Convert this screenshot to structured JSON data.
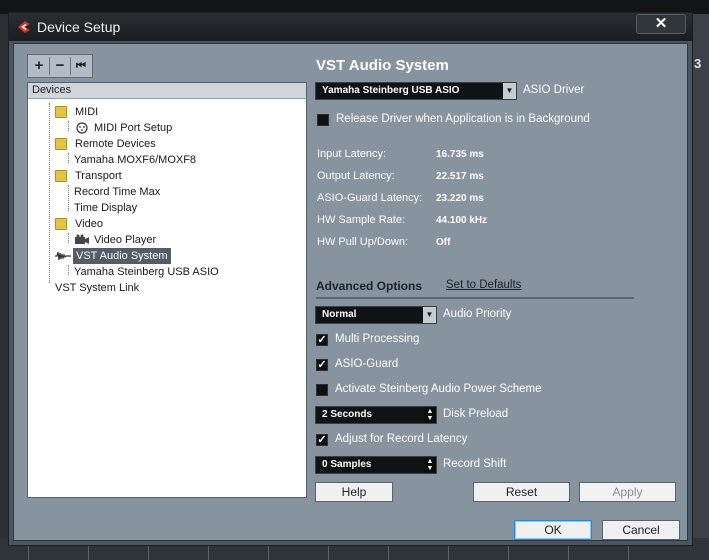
{
  "window": {
    "title": "Device Setup",
    "close_label": "✕"
  },
  "toolbar": {
    "add": "+",
    "remove": "−",
    "reset": "⏮"
  },
  "tree": {
    "header": "Devices",
    "items": [
      {
        "label": "MIDI"
      },
      {
        "label": "MIDI Port Setup"
      },
      {
        "label": "Remote Devices"
      },
      {
        "label": "Yamaha MOXF6/MOXF8"
      },
      {
        "label": "Transport"
      },
      {
        "label": "Record Time Max"
      },
      {
        "label": "Time Display"
      },
      {
        "label": "Video"
      },
      {
        "label": "Video Player"
      },
      {
        "label": "VST Audio System"
      },
      {
        "label": "Yamaha Steinberg USB ASIO"
      },
      {
        "label": "VST System Link"
      }
    ]
  },
  "vst": {
    "title": "VST Audio System",
    "asio_driver_value": "Yamaha Steinberg USB ASIO",
    "asio_driver_label": "ASIO Driver",
    "release_driver_label": "Release Driver when Application is in Background",
    "release_driver_checked": false,
    "latency": [
      {
        "label": "Input Latency:",
        "value": "16.735 ms"
      },
      {
        "label": "Output Latency:",
        "value": "22.517 ms"
      },
      {
        "label": "ASIO-Guard Latency:",
        "value": "23.220 ms"
      },
      {
        "label": "HW Sample Rate:",
        "value": "44.100 kHz"
      },
      {
        "label": "HW Pull Up/Down:",
        "value": "Off"
      }
    ]
  },
  "advanced": {
    "title": "Advanced Options",
    "defaults_link": "Set to Defaults",
    "audio_priority_value": "Normal",
    "audio_priority_label": "Audio Priority",
    "multi_processing_label": "Multi Processing",
    "multi_processing_checked": true,
    "asio_guard_label": "ASIO-Guard",
    "asio_guard_checked": true,
    "power_scheme_label": "Activate Steinberg Audio Power Scheme",
    "power_scheme_checked": false,
    "disk_preload_value": "2 Seconds",
    "disk_preload_label": "Disk Preload",
    "adjust_latency_label": "Adjust for Record Latency",
    "adjust_latency_checked": true,
    "record_shift_value": "0 Samples",
    "record_shift_label": "Record Shift"
  },
  "buttons": {
    "help": "Help",
    "reset": "Reset",
    "apply": "Apply",
    "ok": "OK",
    "cancel": "Cancel"
  },
  "background": {
    "ruler_number": "3"
  },
  "colors": {
    "dialog_bg": "#8893a0",
    "titlebar": "#1a1d20",
    "selected_row": "#545d67",
    "ok_focus": "#2b89cf"
  }
}
